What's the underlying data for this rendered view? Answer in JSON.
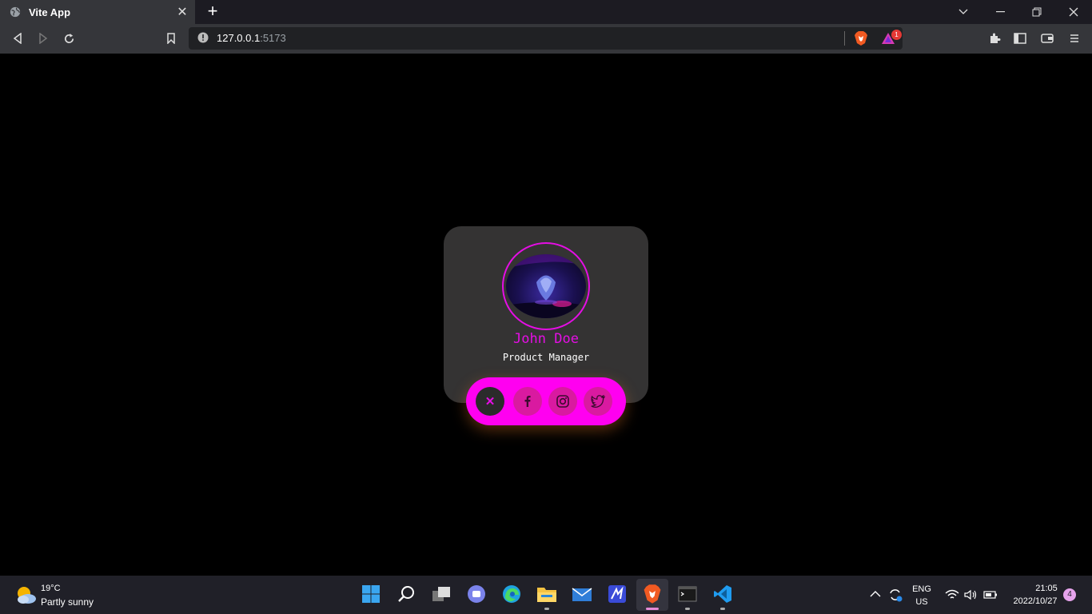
{
  "browser": {
    "tab_title": "Vite App",
    "tab_close": "✕",
    "new_tab": "+",
    "url_host": "127.0.0.1",
    "url_port": ":5173",
    "shields_badge": "1"
  },
  "profile": {
    "name": "John Doe",
    "role": "Product Manager"
  },
  "social": {
    "close_glyph": "✕",
    "icons": [
      "close-icon",
      "facebook-icon",
      "instagram-icon",
      "twitter-icon"
    ]
  },
  "taskbar": {
    "weather_temp": "19°C",
    "weather_desc": "Partly sunny",
    "lang_top": "ENG",
    "lang_bottom": "US",
    "time": "21:05",
    "date": "2022/10/27",
    "notification_count": "4"
  },
  "colors": {
    "accent": "#e50ee5",
    "pill": "#ff00f0",
    "card": "#343333",
    "page_bg": "#000000"
  }
}
